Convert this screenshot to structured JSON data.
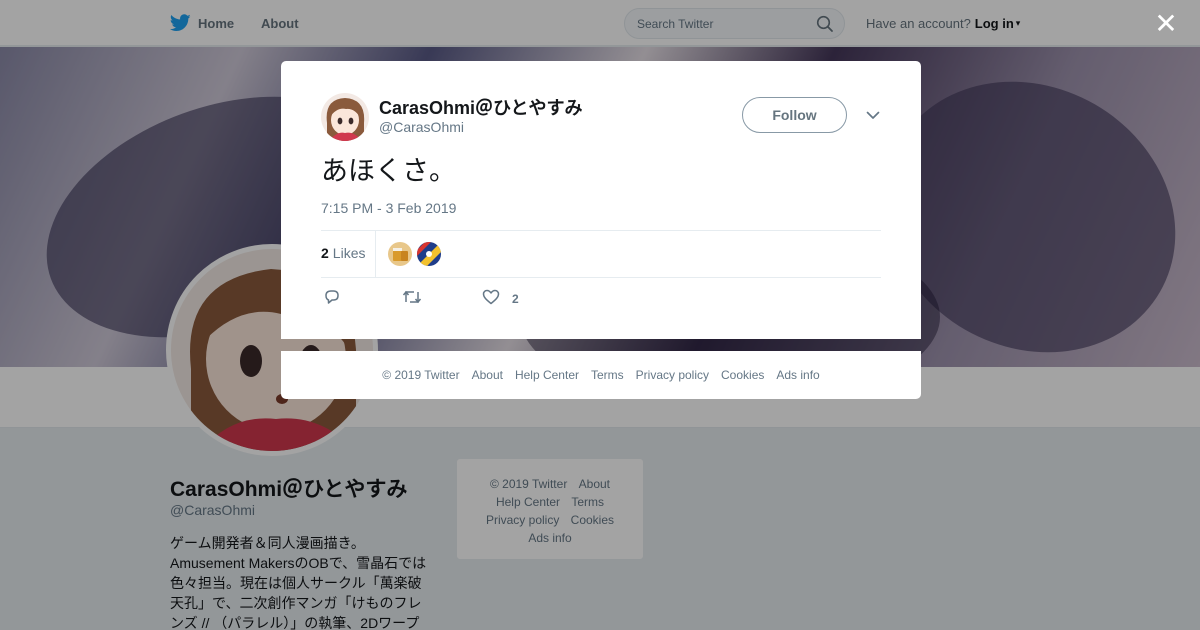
{
  "nav": {
    "home_label": "Home",
    "about_label": "About",
    "search_placeholder": "Search Twitter",
    "account_prompt": "Have an account?",
    "login_label": "Log in"
  },
  "profile": {
    "display_name": "CarasOhmi＠ひとやすみ",
    "handle": "@CarasOhmi",
    "bio": "ゲーム開発者＆同人漫画描き。Amusement MakersのOBで、雪晶石では色々担当。現在は個人サークル「萬楽破天孔」で、二次創作マンガ「けものフレンズ // （パラレル）」の執筆、2Dワープ"
  },
  "side_footer": {
    "copyright": "© 2019 Twitter",
    "about": "About",
    "help": "Help Center",
    "terms": "Terms",
    "privacy": "Privacy policy",
    "cookies": "Cookies",
    "ads": "Ads info"
  },
  "tweet": {
    "display_name": "CarasOhmi＠ひとやすみ",
    "handle": "@CarasOhmi",
    "follow_label": "Follow",
    "text": "あほくさ。",
    "timestamp": "7:15 PM - 3 Feb 2019",
    "likes_count": "2",
    "likes_label": "Likes",
    "like_action_count": "2"
  },
  "modal_footer": {
    "copyright": "© 2019 Twitter",
    "about": "About",
    "help": "Help Center",
    "terms": "Terms",
    "privacy": "Privacy policy",
    "cookies": "Cookies",
    "ads": "Ads info"
  },
  "colors": {
    "twitter_blue": "#1da1f2",
    "text_primary": "#14171a",
    "text_secondary": "#657786"
  },
  "icons": [
    "twitter-bird-icon",
    "search-icon",
    "close-icon",
    "chevron-down-icon",
    "reply-icon",
    "retweet-icon",
    "heart-icon"
  ]
}
